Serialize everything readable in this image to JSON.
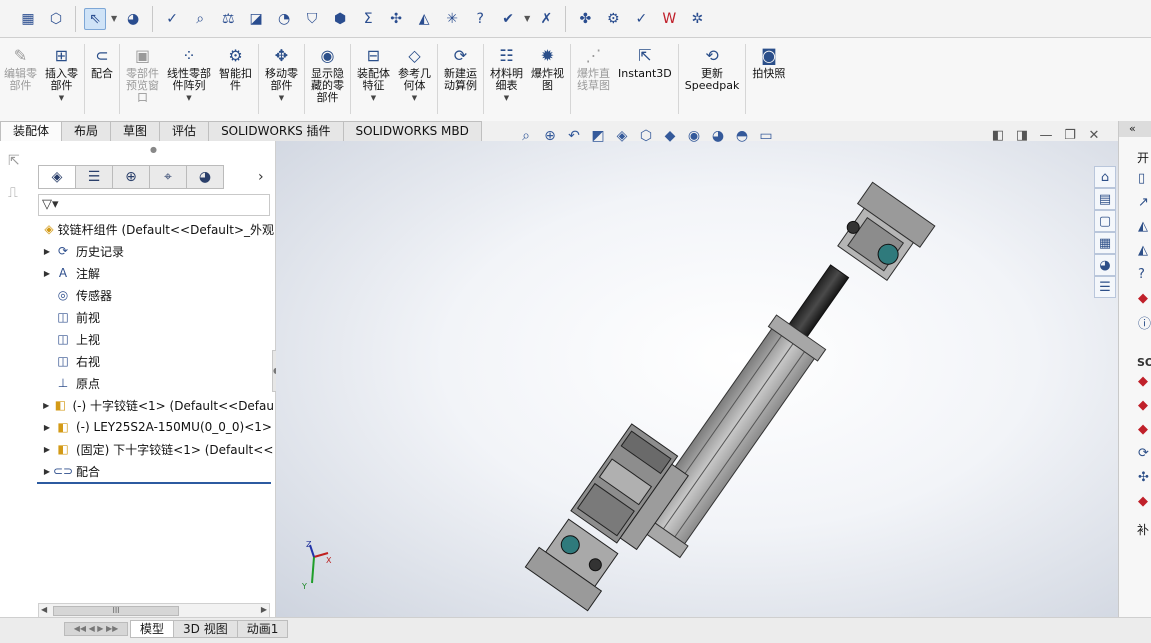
{
  "top_toolbar": {
    "groups": [
      [
        "open-doc-icon",
        "rebuild-icon",
        "select-icon",
        "appearance-icon"
      ],
      [
        "spell-icon",
        "measure-icon",
        "mass-props-icon",
        "section-props-icon",
        "sensors-icon",
        "check-icon",
        "geometry-icon",
        "sum-icon",
        "interference-icon",
        "clearance-icon",
        "hole-align-icon",
        "statistics-icon",
        "evaluate-icon",
        "options-icon"
      ],
      [
        "simulation-icon",
        "toolbox-icon",
        "motion-icon",
        "word-icon",
        "settings-icon"
      ]
    ]
  },
  "ribbon": {
    "buttons": [
      {
        "id": "edit-component",
        "label": "编辑零\n部件",
        "icon": "✎",
        "disabled": true,
        "caret": false
      },
      {
        "id": "insert-component",
        "label": "插入零\n部件",
        "icon": "⊞",
        "disabled": false,
        "caret": true
      },
      {
        "id": "mate",
        "label": "配合",
        "icon": "⊂",
        "disabled": false,
        "caret": false
      },
      {
        "id": "component-preview",
        "label": "零部件\n预览窗\n口",
        "icon": "▣",
        "disabled": true,
        "caret": false
      },
      {
        "id": "linear-pattern",
        "label": "线性零部\n件阵列",
        "icon": "⁘",
        "disabled": false,
        "caret": true
      },
      {
        "id": "smart-fasteners",
        "label": "智能扣\n件",
        "icon": "⚙",
        "disabled": false,
        "caret": false
      },
      {
        "id": "move-component",
        "label": "移动零\n部件",
        "icon": "✥",
        "disabled": false,
        "caret": true
      },
      {
        "id": "show-hidden",
        "label": "显示隐\n藏的零\n部件",
        "icon": "◉",
        "disabled": false,
        "caret": false
      },
      {
        "id": "assembly-features",
        "label": "装配体\n特征",
        "icon": "⊟",
        "disabled": false,
        "caret": true
      },
      {
        "id": "reference-geometry",
        "label": "参考几\n何体",
        "icon": "◇",
        "disabled": false,
        "caret": true
      },
      {
        "id": "new-motion-study",
        "label": "新建运\n动算例",
        "icon": "⟳",
        "disabled": false,
        "caret": false
      },
      {
        "id": "bom",
        "label": "材料明\n细表",
        "icon": "☷",
        "disabled": false,
        "caret": true
      },
      {
        "id": "exploded-view",
        "label": "爆炸视\n图",
        "icon": "✹",
        "disabled": false,
        "caret": false
      },
      {
        "id": "explode-line-sketch",
        "label": "爆炸直\n线草图",
        "icon": "⋰",
        "disabled": true,
        "caret": false
      },
      {
        "id": "instant3d",
        "label": "Instant3D",
        "icon": "⇱",
        "disabled": false,
        "caret": false
      },
      {
        "id": "update-speedpak",
        "label": "更新\nSpeedpak",
        "icon": "⟲",
        "disabled": false,
        "caret": false
      },
      {
        "id": "snapshot",
        "label": "拍快照",
        "icon": "◙",
        "disabled": false,
        "caret": false
      }
    ],
    "tabs": [
      {
        "label": "装配体",
        "active": true
      },
      {
        "label": "布局",
        "active": false
      },
      {
        "label": "草图",
        "active": false
      },
      {
        "label": "评估",
        "active": false
      },
      {
        "label": "SOLIDWORKS 插件",
        "active": false
      },
      {
        "label": "SOLIDWORKS MBD",
        "active": false
      }
    ]
  },
  "feature_manager": {
    "tabs": [
      {
        "name": "feature-tree-tab",
        "icon": "◈",
        "active": true
      },
      {
        "name": "property-manager-tab",
        "icon": "☰",
        "active": false
      },
      {
        "name": "configuration-tab",
        "icon": "⊕",
        "active": false
      },
      {
        "name": "dimxpert-tab",
        "icon": "⌖",
        "active": false
      },
      {
        "name": "display-manager-tab",
        "icon": "◕",
        "active": false
      }
    ],
    "filter": "▽▾",
    "tree": [
      {
        "label": "铰链杆组件  (Default<<Default>_外观",
        "icon": "◈",
        "expander": "",
        "indent": 0,
        "part": true
      },
      {
        "label": "历史记录",
        "icon": "⟳",
        "expander": "▶",
        "indent": 1,
        "part": false
      },
      {
        "label": "注解",
        "icon": "A",
        "expander": "▶",
        "indent": 1,
        "part": false
      },
      {
        "label": "传感器",
        "icon": "◎",
        "expander": "",
        "indent": 1,
        "part": false
      },
      {
        "label": "前视",
        "icon": "◫",
        "expander": "",
        "indent": 1,
        "part": false
      },
      {
        "label": "上视",
        "icon": "◫",
        "expander": "",
        "indent": 1,
        "part": false
      },
      {
        "label": "右视",
        "icon": "◫",
        "expander": "",
        "indent": 1,
        "part": false
      },
      {
        "label": "原点",
        "icon": "⊥",
        "expander": "",
        "indent": 1,
        "part": false
      },
      {
        "label": "(-) 十字铰链<1>  (Default<<Defau",
        "icon": "◧",
        "expander": "▶",
        "indent": 1,
        "part": true
      },
      {
        "label": "(-) LEY25S2A-150MU(0_0_0)<1>",
        "icon": "◧",
        "expander": "▶",
        "indent": 1,
        "part": true
      },
      {
        "label": "(固定) 下十字铰链<1>  (Default<<",
        "icon": "◧",
        "expander": "▶",
        "indent": 1,
        "part": true
      },
      {
        "label": "配合",
        "icon": "⊂⊃",
        "expander": "▶",
        "indent": 1,
        "part": false
      }
    ],
    "scroll_label": "III"
  },
  "bottom_tabs": [
    {
      "label": "模型",
      "active": true
    },
    {
      "label": "3D 视图",
      "active": false
    },
    {
      "label": "动画1",
      "active": false
    }
  ],
  "view_toolbar": [
    "zoom-fit-icon",
    "zoom-area-icon",
    "previous-view-icon",
    "section-view-icon",
    "dynamic-annotation-icon",
    "view-orientation-icon",
    "display-style-icon",
    "hide-show-icon",
    "edit-appearance-icon",
    "apply-scene-icon",
    "view-settings-icon"
  ],
  "task_pane": {
    "collapse": "«",
    "title": "开",
    "sol_label": "SO",
    "bottom_label": "补"
  },
  "triad": {
    "x": "X",
    "y": "Y",
    "z": "Z"
  }
}
